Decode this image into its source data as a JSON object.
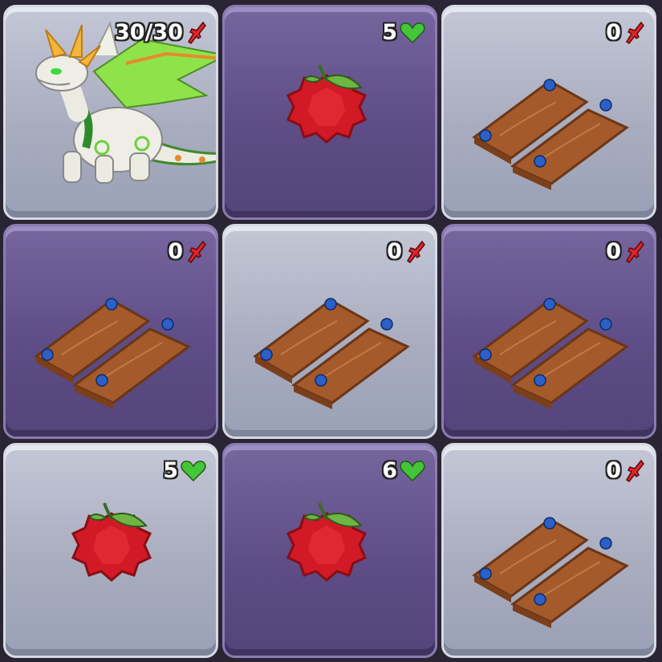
{
  "board": {
    "tiles": [
      {
        "type": "dragon",
        "counter": "30/30",
        "counter_icon": "sword-icon"
      },
      {
        "type": "fruit",
        "counter": "5",
        "counter_icon": "heart-icon"
      },
      {
        "type": "planks",
        "counter": "0",
        "counter_icon": "sword-icon"
      },
      {
        "type": "planks",
        "counter": "0",
        "counter_icon": "sword-icon"
      },
      {
        "type": "planks",
        "counter": "0",
        "counter_icon": "sword-icon"
      },
      {
        "type": "planks",
        "counter": "0",
        "counter_icon": "sword-icon"
      },
      {
        "type": "fruit",
        "counter": "5",
        "counter_icon": "heart-icon"
      },
      {
        "type": "fruit",
        "counter": "6",
        "counter_icon": "heart-icon"
      },
      {
        "type": "planks",
        "counter": "0",
        "counter_icon": "sword-icon"
      }
    ]
  },
  "colors": {
    "heart": "#44c53a",
    "sword": "#e2242a",
    "fruit": "#d11a25",
    "plank": "#a45a2a",
    "gem": "#2d5fc9"
  }
}
